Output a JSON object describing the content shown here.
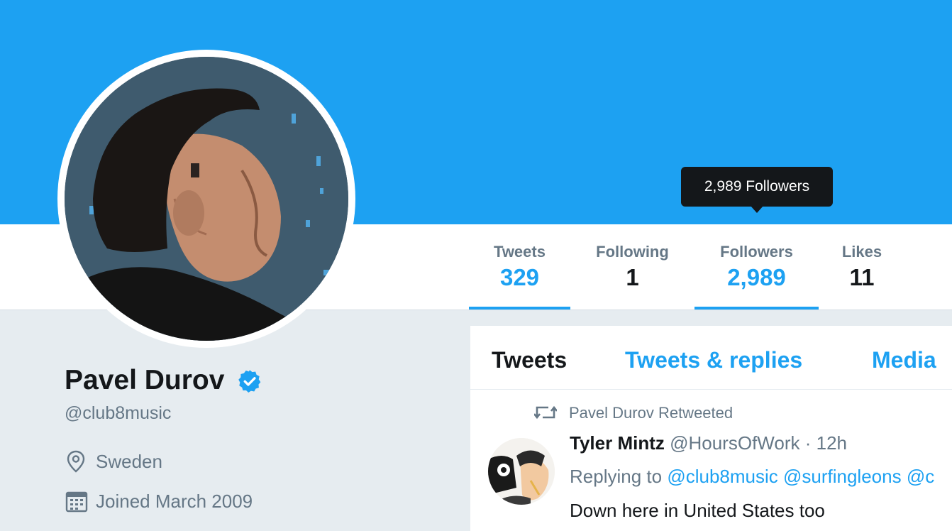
{
  "profile": {
    "name": "Pavel Durov",
    "handle": "@club8music",
    "location": "Sweden",
    "joined": "Joined March 2009"
  },
  "stats": [
    {
      "label": "Tweets",
      "value": "329"
    },
    {
      "label": "Following",
      "value": "1"
    },
    {
      "label": "Followers",
      "value": "2,989"
    },
    {
      "label": "Likes",
      "value": "11"
    }
  ],
  "tooltip": {
    "text": "2,989 Followers"
  },
  "tabs": [
    {
      "label": "Tweets"
    },
    {
      "label": "Tweets & replies"
    },
    {
      "label": "Media"
    }
  ],
  "tweet": {
    "retweet_context": "Pavel Durov Retweeted",
    "author_name": "Tyler Mintz",
    "author_handle": "@HoursOfWork",
    "separator": "·",
    "time": "12h",
    "replying_prefix": "Replying to",
    "mentions": [
      "@club8music",
      "@surfingleons",
      "@c"
    ],
    "text": "Down here in United States too"
  },
  "icons": {
    "verified": "verified-badge-icon",
    "location": "location-pin-icon",
    "calendar": "calendar-icon",
    "retweet": "retweet-icon"
  },
  "colors": {
    "brand": "#1da1f2",
    "text_primary": "#14171a",
    "text_secondary": "#657786",
    "page_bg": "#e6ecf0"
  }
}
